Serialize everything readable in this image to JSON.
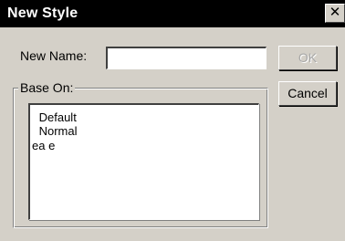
{
  "dialog": {
    "title": "New Style",
    "close_glyph": "✕"
  },
  "form": {
    "name_label": "New Name:",
    "name_value": "",
    "base_label": "Base On:",
    "base_options": [
      " Default",
      " Normal",
      "ea e"
    ]
  },
  "buttons": {
    "ok_label": "OK",
    "cancel_label": "Cancel"
  },
  "colors": {
    "face": "#d4d0c8",
    "title_bar": "#000000",
    "disabled_text": "#a8a8a8"
  }
}
